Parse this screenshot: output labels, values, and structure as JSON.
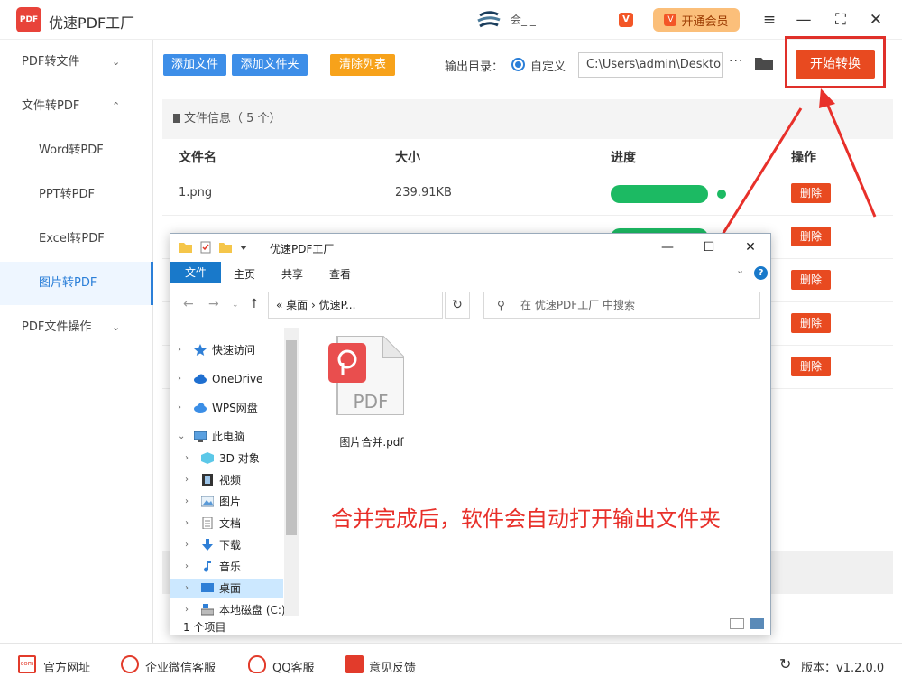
{
  "app": {
    "title": "优速PDF工厂",
    "logo_text": "PDF",
    "user_name": "会_ _",
    "vip_label": "开通会员",
    "vip_badge": "V",
    "version": "版本：v1.2.0.0",
    "accent_color": "#2b7fd8",
    "danger_color": "#e84a20"
  },
  "window_controls": {
    "menu": "≡",
    "minimize": "—",
    "maximize": "⛶",
    "close": "✕"
  },
  "sidebar": {
    "items": [
      {
        "label": "PDF转文件",
        "chevron": "⌄"
      },
      {
        "label": "文件转PDF",
        "chevron": "⌃"
      },
      {
        "label": "Word转PDF"
      },
      {
        "label": "PPT转PDF"
      },
      {
        "label": "Excel转PDF"
      },
      {
        "label": "图片转PDF"
      },
      {
        "label": "PDF文件操作",
        "chevron": "⌄"
      }
    ]
  },
  "toolbar": {
    "add_file": "添加文件",
    "add_folder": "添加文件夹",
    "clear_list": "清除列表",
    "output_label": "输出目录：",
    "radio_label": "自定义",
    "output_path": "C:\\Users\\admin\\Deskto",
    "more": "···",
    "start": "开始转换"
  },
  "file_panel": {
    "info": "文件信息（ 5 个）",
    "columns": [
      "文件名",
      "大小",
      "进度",
      "操作"
    ],
    "rows": [
      {
        "name": "1.png",
        "size": "239.91KB",
        "action": "删除"
      },
      {
        "name": "",
        "size": "",
        "action": "删除"
      },
      {
        "name": "",
        "size": "",
        "action": "删除"
      },
      {
        "name": "",
        "size": "",
        "action": "删除"
      },
      {
        "name": "",
        "size": "",
        "action": "删除"
      }
    ]
  },
  "explorer": {
    "title": "优速PDF工厂",
    "ribbon_tabs": [
      "文件",
      "主页",
      "共享",
      "查看"
    ],
    "address": "«  桌面  ›  优速P...",
    "search_placeholder": "在 优速PDF工厂 中搜索",
    "tree": [
      {
        "label": "快速访问",
        "icon": "star-icon"
      },
      {
        "label": "OneDrive",
        "icon": "cloud-icon"
      },
      {
        "label": "WPS网盘",
        "icon": "wps-cloud-icon"
      },
      {
        "label": "此电脑",
        "icon": "computer-icon"
      },
      {
        "label": "3D 对象",
        "icon": "cube-icon"
      },
      {
        "label": "视频",
        "icon": "video-icon"
      },
      {
        "label": "图片",
        "icon": "picture-icon"
      },
      {
        "label": "文档",
        "icon": "document-icon"
      },
      {
        "label": "下载",
        "icon": "download-icon"
      },
      {
        "label": "音乐",
        "icon": "music-icon"
      },
      {
        "label": "桌面",
        "icon": "desktop-icon"
      },
      {
        "label": "本地磁盘 (C:)",
        "icon": "drive-icon"
      }
    ],
    "file_name": "图片合并.pdf",
    "file_icon_text": "PDF",
    "status": "1 个项目"
  },
  "annotation": "合并完成后，软件会自动打开输出文件夹",
  "footer": {
    "website": "官方网址",
    "wechat": "企业微信客服",
    "qq": "QQ客服",
    "feedback": "意见反馈"
  }
}
